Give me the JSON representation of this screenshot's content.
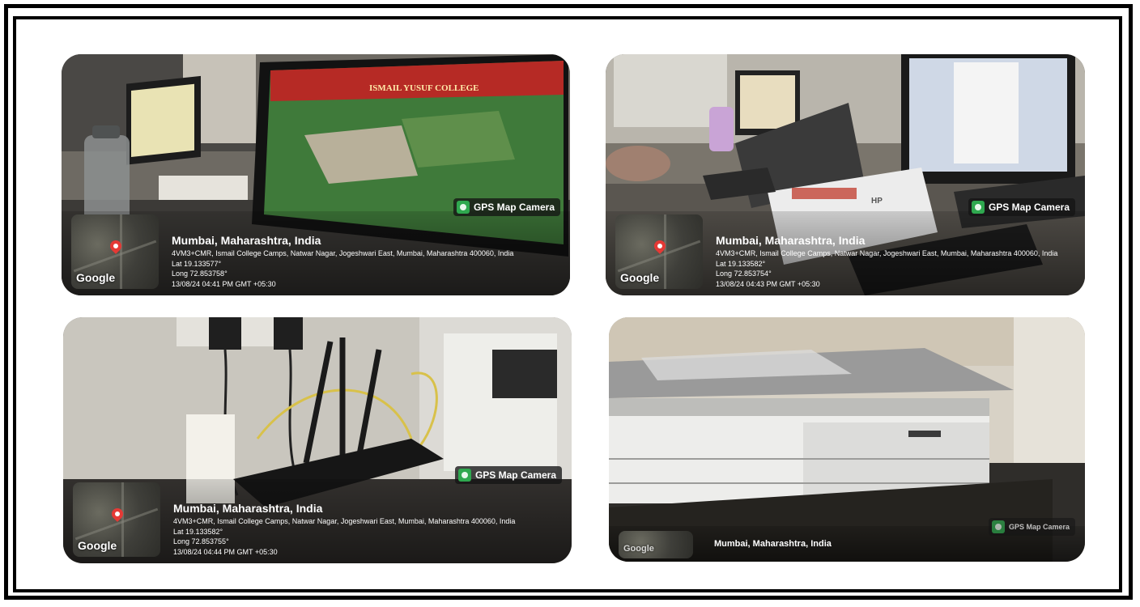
{
  "photos": [
    {
      "badge": "GPS Map Camera",
      "city": "Mumbai, Maharashtra, India",
      "address": "4VM3+CMR, Ismail College Camps, Natwar Nagar, Jogeshwari East, Mumbai, Maharashtra 400060, India",
      "lat": "Lat 19.133577°",
      "long": "Long 72.853758°",
      "datetime": "13/08/24 04:41 PM GMT +05:30",
      "map_label": "Google"
    },
    {
      "badge": "GPS Map Camera",
      "city": "Mumbai, Maharashtra, India",
      "address": "4VM3+CMR, Ismail College Camps, Natwar Nagar, Jogeshwari East, Mumbai, Maharashtra 400060, India",
      "lat": "Lat 19.133582°",
      "long": "Long 72.853754°",
      "datetime": "13/08/24 04:43 PM GMT +05:30",
      "map_label": "Google"
    },
    {
      "badge": "GPS Map Camera",
      "city": "Mumbai, Maharashtra, India",
      "address": "4VM3+CMR, Ismail College Camps, Natwar Nagar, Jogeshwari East, Mumbai, Maharashtra 400060, India",
      "lat": "Lat 19.133582°",
      "long": "Long 72.853755°",
      "datetime": "13/08/24 04:44 PM GMT +05:30",
      "map_label": "Google"
    },
    {
      "badge": "GPS Map Camera",
      "city": "Mumbai, Maharashtra, India",
      "map_label": "Google"
    }
  ],
  "monitor_text": {
    "college_name": "ISMAIL YUSUF COLLEGE",
    "scanner_brand": "HP"
  }
}
